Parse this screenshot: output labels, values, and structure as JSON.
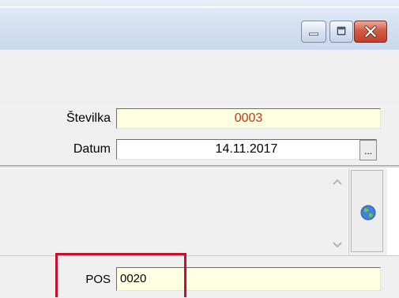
{
  "window": {
    "controls": {
      "minimize_icon": "minimize-icon",
      "maximize_icon": "maximize-icon",
      "close_icon": "close-icon"
    }
  },
  "form": {
    "stevilka_label": "Številka",
    "stevilka_value": "0003",
    "datum_label": "Datum",
    "datum_value": "14.11.2017",
    "datum_button_label": "...",
    "pos_label": "POS",
    "pos_value": "0020"
  },
  "colors": {
    "highlight": "#c8102e",
    "required_field_bg": "#ffffe1",
    "number_text": "#c0391b"
  },
  "icons": [
    "scroll-up-icon",
    "scroll-down-icon",
    "globe-icon"
  ]
}
